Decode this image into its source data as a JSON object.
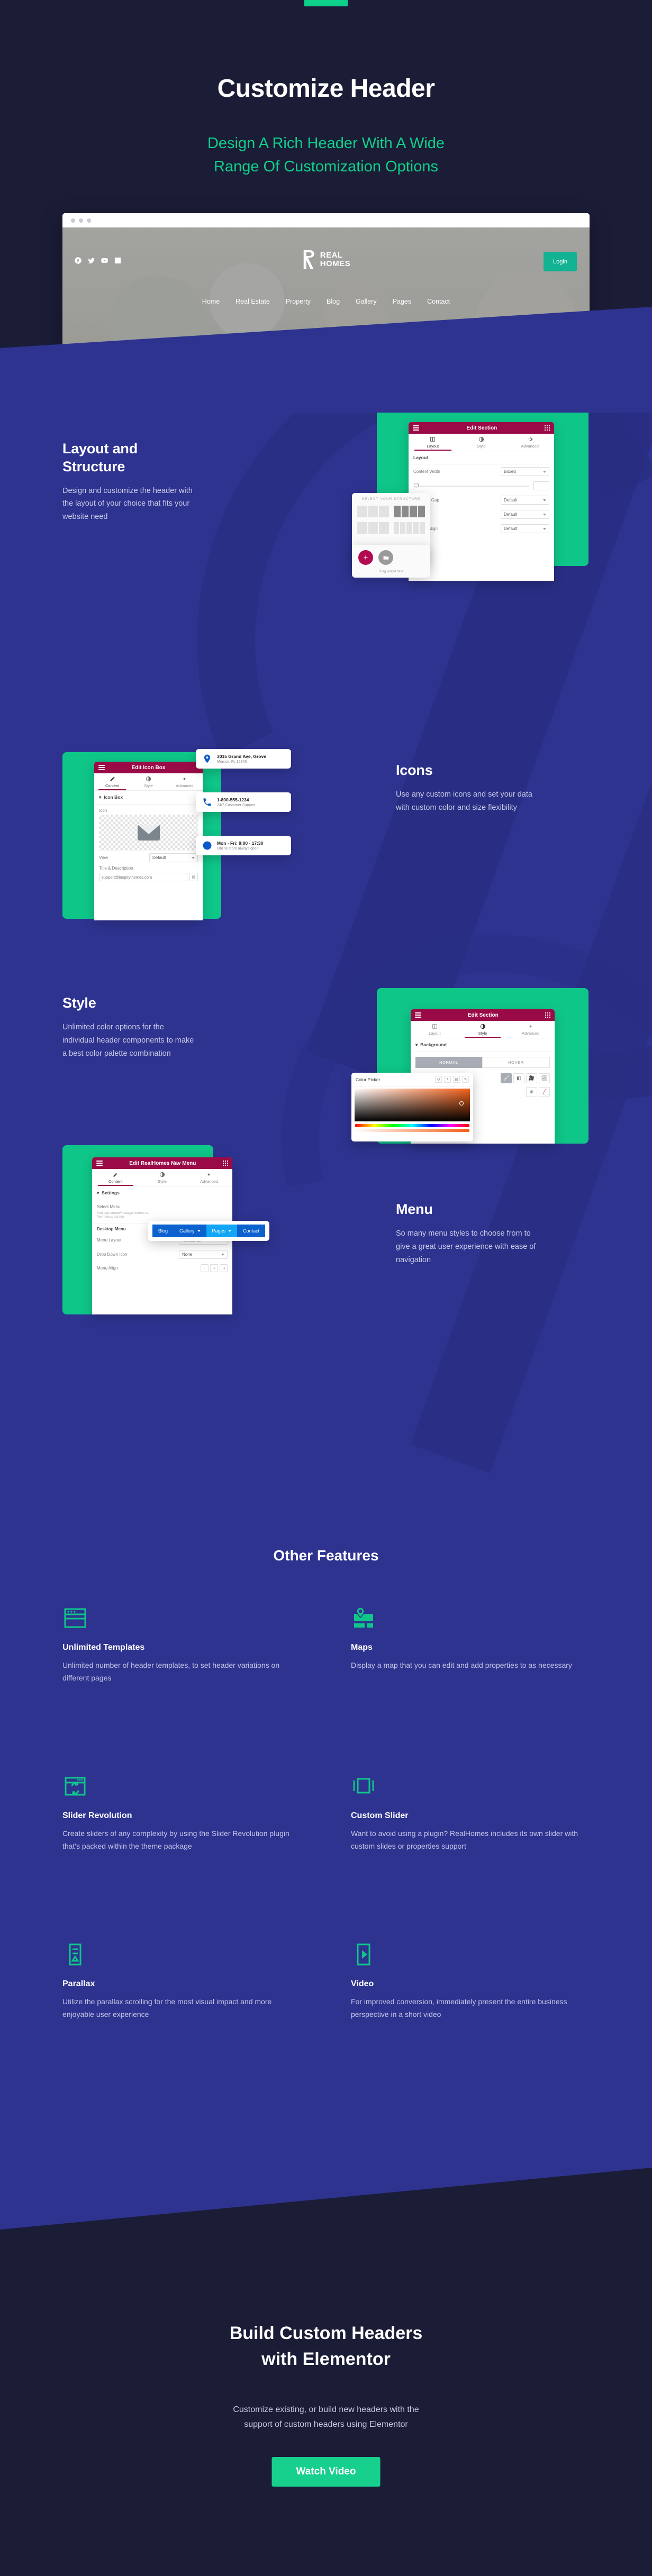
{
  "hero": {
    "title": "Customize Header",
    "subtitle_line1": "Design A Rich Header With A Wide",
    "subtitle_line2": "Range Of Customization Options",
    "browser": {
      "logo_line1": "REAL",
      "logo_line2": "HOMES",
      "login_label": "Login",
      "nav_items": [
        "Home",
        "Real Estate",
        "Property",
        "Blog",
        "Gallery",
        "Pages",
        "Contact"
      ],
      "socials": [
        "facebook-icon",
        "twitter-icon",
        "youtube-icon",
        "linkedin-icon"
      ]
    }
  },
  "features": [
    {
      "title": "Layout and Structure",
      "desc": "Design and customize the header with the layout of your choice that fits your website need",
      "panel": {
        "header_title": "Edit Section",
        "tabs": [
          "Layout",
          "Style",
          "Advanced"
        ],
        "active_tab": "Layout",
        "section_label": "Layout",
        "rows": [
          {
            "label": "Content Width",
            "value": "Boxed"
          },
          {
            "label": "Columns Gap",
            "value": "Default"
          },
          {
            "label": "Height",
            "value": "Default"
          },
          {
            "label": "Vertical Align",
            "value": "Default"
          }
        ],
        "structure_popup_label": "SELECT YOUR STRUCTURE",
        "drag_hint": "Drag widget here"
      }
    },
    {
      "title": "Icons",
      "desc": "Use any custom icons and set your data with custom color and size flexibility",
      "panel": {
        "header_title": "Edit Icon Box",
        "tabs": [
          "Content",
          "Style",
          "Advanced"
        ],
        "active_tab": "Content",
        "section_label": "Icon Box",
        "icon_field_label": "Icon",
        "view_label": "View",
        "view_value": "Default",
        "title_desc_label": "Title & Description",
        "title_desc_value": "support@inspirythemes.com"
      },
      "info_cards": [
        {
          "icon": "map-pin-icon",
          "title": "3015 Grand Ave, Grove",
          "desc": "Merrick, FL 12345"
        },
        {
          "icon": "phone-icon",
          "title": "1-800-555-1234",
          "desc": "24/7 Customer Support"
        },
        {
          "icon": "clock-icon",
          "title": "Mon - Fri: 9:00 - 17:30",
          "desc": "Online store always open"
        }
      ]
    },
    {
      "title": "Style",
      "desc": "Unlimited color options for the individual header components to make a best color palette combination",
      "panel": {
        "header_title": "Edit Section",
        "tabs": [
          "Layout",
          "Style",
          "Advanced"
        ],
        "active_tab": "Style",
        "section_label": "Background",
        "state_tabs": [
          "NORMAL",
          "HOVER"
        ],
        "active_state": "NORMAL"
      },
      "color_picker": {
        "title": "Color Picker"
      }
    },
    {
      "title": "Menu",
      "desc": "So many menu styles to choose from to give a great user experience with ease of navigation",
      "panel": {
        "header_title": "Edit RealHomes Nav Menu",
        "tabs": [
          "Content",
          "Style",
          "Advanced"
        ],
        "active_tab": "Content",
        "section_label": "Settings",
        "select_menu_label": "Select Menu",
        "select_menu_hint": "You can create/manage menus on the menus screen",
        "desktop_menu_label": "Desktop Menu",
        "rows": [
          {
            "label": "Menu Layout",
            "value": "Horizontal"
          },
          {
            "label": "Drop Down Icon",
            "value": "None"
          }
        ],
        "menu_align_label": "Menu Align",
        "menu_align_options": [
          "align-left-icon",
          "align-center-icon",
          "align-right-icon"
        ]
      },
      "menu_preview": [
        "Blog",
        "Gallery",
        "Pages",
        "Contact"
      ],
      "menu_preview_active": "Pages"
    }
  ],
  "other_features": {
    "heading": "Other Features",
    "items": [
      {
        "icon": "browser-window-icon",
        "title": "Unlimited Templates",
        "desc": "Unlimited number of header templates, to set header variations on different pages"
      },
      {
        "icon": "map-icon",
        "title": "Maps",
        "desc": "Display a map that you can edit and add properties to as necessary"
      },
      {
        "icon": "refresh-window-icon",
        "title": "Slider Revolution",
        "desc": "Create sliders of any complexity by using the Slider Revolution plugin that's packed within the theme package"
      },
      {
        "icon": "carousel-icon",
        "title": "Custom Slider",
        "desc": "Want to avoid using a plugin? RealHomes includes its own slider with custom slides or properties support"
      },
      {
        "icon": "parallax-icon",
        "title": "Parallax",
        "desc": "Utilize the parallax scrolling for the most visual impact and more enjoyable user experience"
      },
      {
        "icon": "video-play-icon",
        "title": "Video",
        "desc": "For improved conversion, immediately present the entire business perspective in a short video"
      }
    ]
  },
  "cta": {
    "title_line1": "Build Custom Headers",
    "title_line2": "with Elementor",
    "subtitle_line1": "Customize existing, or build new headers with the",
    "subtitle_line2": "support of custom headers using Elementor",
    "button_label": "Watch Video"
  },
  "colors": {
    "dark": "#1b1c36",
    "blue": "#2e3390",
    "green": "#0fc689",
    "accent_green": "#17d08d",
    "panel_header": "#9a0a46"
  }
}
